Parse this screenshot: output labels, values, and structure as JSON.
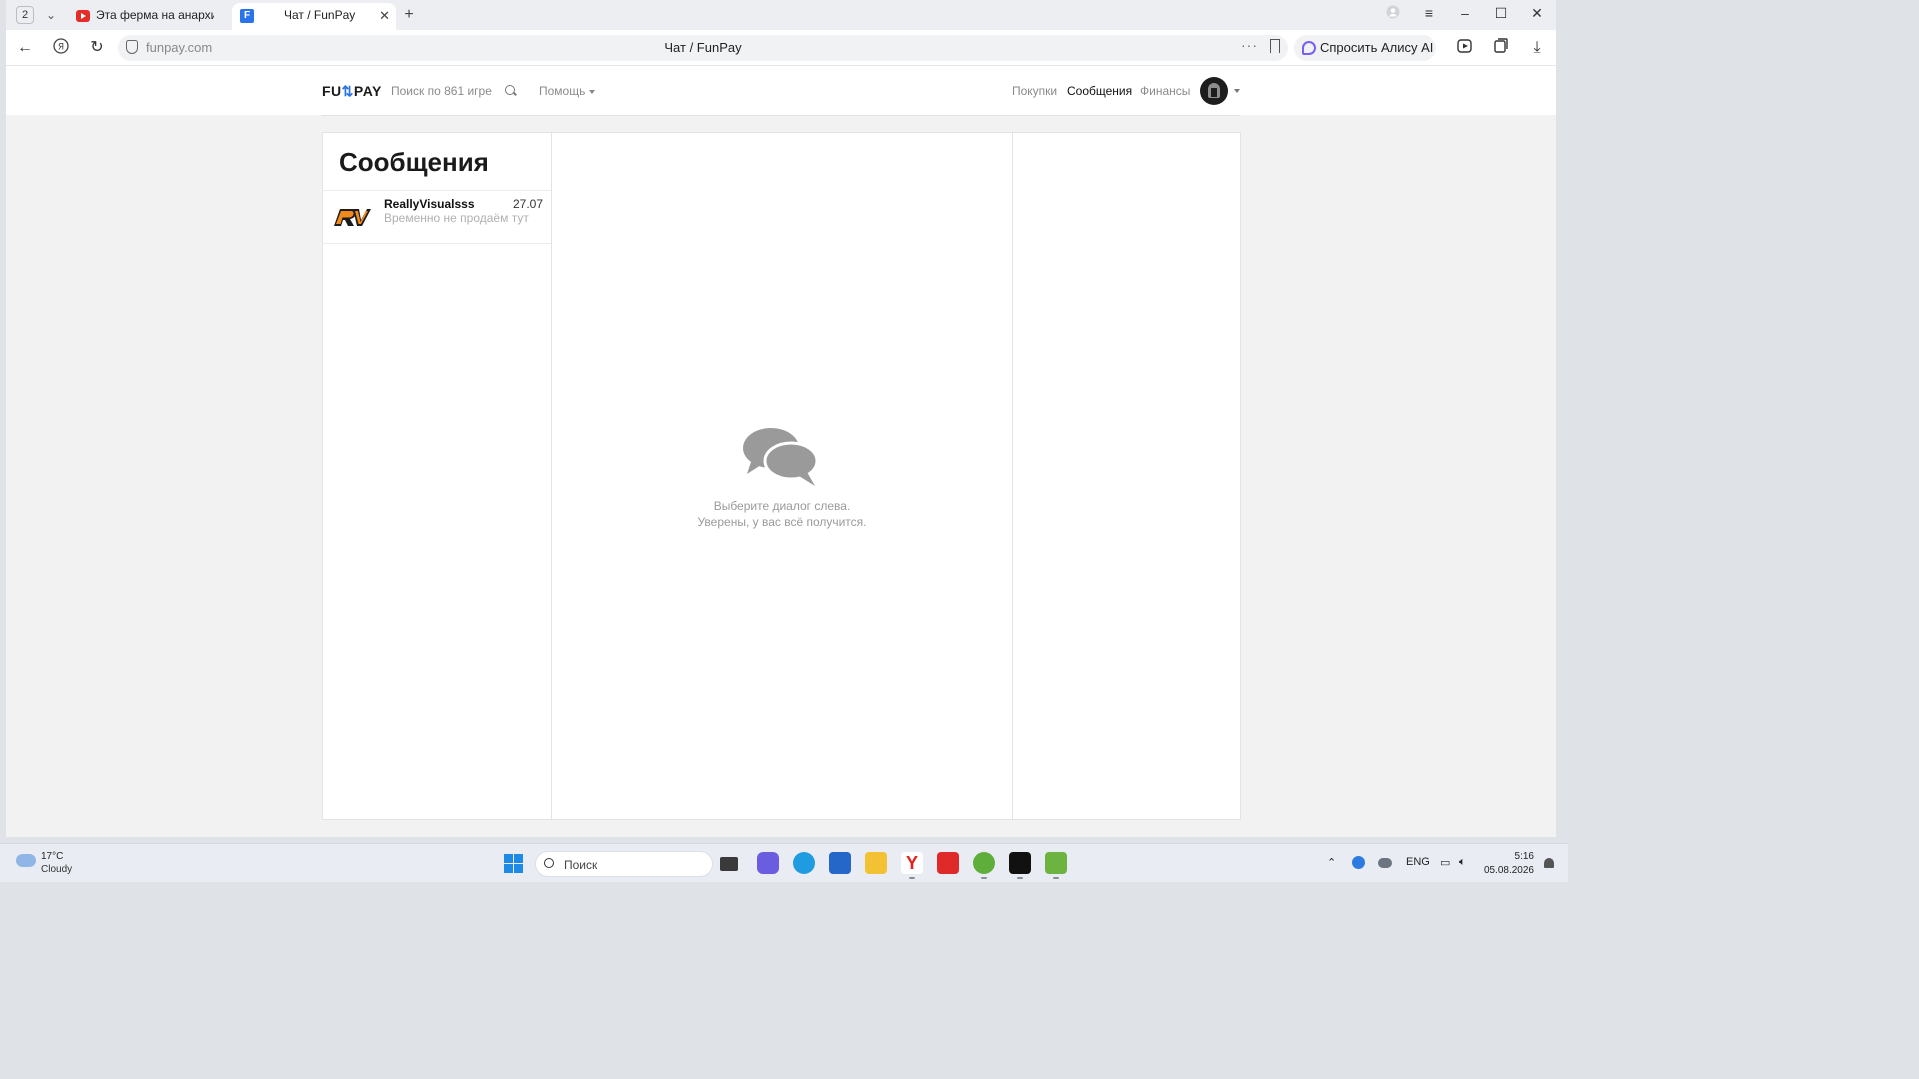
{
  "browser": {
    "tab_count": "2",
    "tabs": [
      {
        "title": "Эта ферма на анархии ст"
      },
      {
        "title": "Чат / FunPay",
        "favicon_letter": "F"
      }
    ],
    "url": "funpay.com",
    "page_title": "Чат / FunPay",
    "alice_button": "Спросить Алису AI"
  },
  "site": {
    "logo_left": "FU",
    "logo_right": "PAY",
    "search_placeholder": "Поиск по 861 игре",
    "help_label": "Помощь",
    "nav": [
      {
        "label": "Покупки"
      },
      {
        "label": "Сообщения"
      },
      {
        "label": "Финансы"
      }
    ]
  },
  "chat": {
    "heading": "Сообщения",
    "contacts": [
      {
        "name": "ReallyVisualsss",
        "date": "27.07",
        "preview": "Временно не продаём тут"
      }
    ],
    "empty_line1": "Выберите диалог слева.",
    "empty_line2": "Уверены, у вас всё получится."
  },
  "taskbar": {
    "weather_temp": "17°C",
    "weather_condition": "Cloudy",
    "search_placeholder": "Поиск",
    "language": "ENG",
    "time": "5:16",
    "date": "05.08.2026"
  }
}
